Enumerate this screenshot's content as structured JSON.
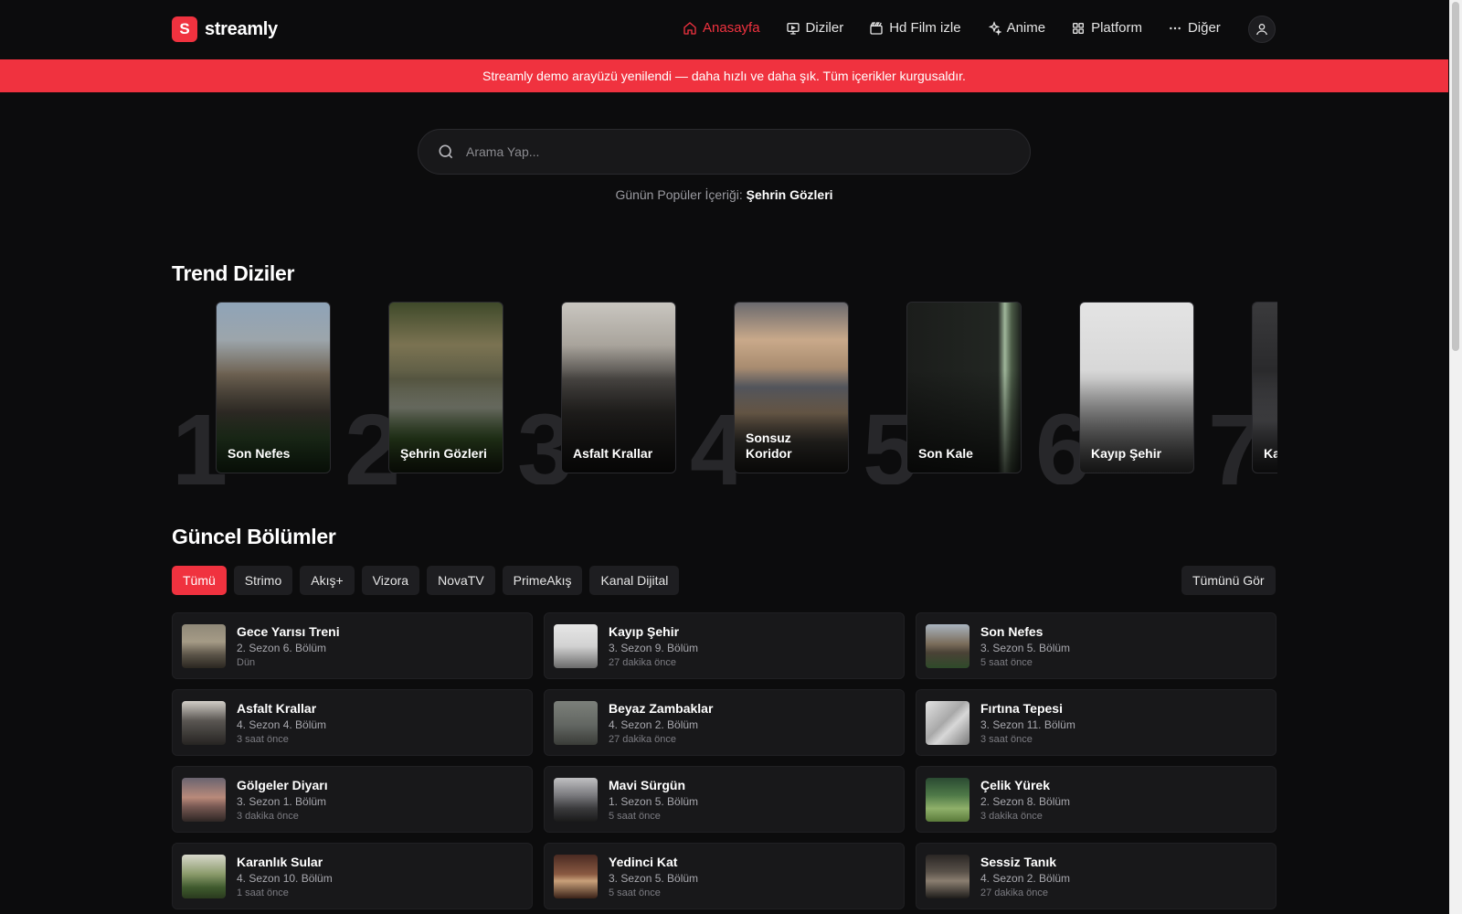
{
  "brand": {
    "logo_letter": "S",
    "name": "streamly"
  },
  "nav": [
    {
      "label": "Anasayfa",
      "icon": "home-icon",
      "active": true
    },
    {
      "label": "Diziler",
      "icon": "tv-icon"
    },
    {
      "label": "Hd Film izle",
      "icon": "clapperboard-icon"
    },
    {
      "label": "Anime",
      "icon": "sparkles-icon"
    },
    {
      "label": "Platform",
      "icon": "grid-icon"
    },
    {
      "label": "Diğer",
      "icon": "more-icon"
    }
  ],
  "banner": {
    "text": "Streamly demo arayüzü yenilendi — daha hızlı ve daha şık. Tüm içerikler kurgusaldır."
  },
  "search": {
    "placeholder": "Arama Yap..."
  },
  "popular": {
    "prefix": "Günün Popüler İçeriği:",
    "title": "Şehrin Gözleri"
  },
  "trend": {
    "title": "Trend Diziler",
    "items": [
      {
        "rank": "1",
        "title": "Son Nefes"
      },
      {
        "rank": "2",
        "title": "Şehrin Gözleri"
      },
      {
        "rank": "3",
        "title": "Asfalt Krallar"
      },
      {
        "rank": "4",
        "title": "Sonsuz Koridor"
      },
      {
        "rank": "5",
        "title": "Son Kale"
      },
      {
        "rank": "6",
        "title": "Kayıp Şehir"
      },
      {
        "rank": "7",
        "title": "Ka"
      }
    ]
  },
  "episodes": {
    "title": "Güncel Bölümler",
    "tabs": [
      "Tümü",
      "Strimo",
      "Akış+",
      "Vizora",
      "NovaTV",
      "PrimeAkış",
      "Kanal Dijital"
    ],
    "active_tab": "Tümü",
    "see_all": "Tümünü Gör",
    "items": [
      {
        "title": "Gece Yarısı Treni",
        "episode": "2. Sezon 6. Bölüm",
        "time": "Dün"
      },
      {
        "title": "Kayıp Şehir",
        "episode": "3. Sezon 9. Bölüm",
        "time": "27 dakika önce"
      },
      {
        "title": "Son Nefes",
        "episode": "3. Sezon 5. Bölüm",
        "time": "5 saat önce"
      },
      {
        "title": "Asfalt Krallar",
        "episode": "4. Sezon 4. Bölüm",
        "time": "3 saat önce"
      },
      {
        "title": "Beyaz Zambaklar",
        "episode": "4. Sezon 2. Bölüm",
        "time": "27 dakika önce"
      },
      {
        "title": "Fırtına Tepesi",
        "episode": "3. Sezon 11. Bölüm",
        "time": "3 saat önce"
      },
      {
        "title": "Gölgeler Diyarı",
        "episode": "3. Sezon 1. Bölüm",
        "time": "3 dakika önce"
      },
      {
        "title": "Mavi Sürgün",
        "episode": "1. Sezon 5. Bölüm",
        "time": "5 saat önce"
      },
      {
        "title": "Çelik Yürek",
        "episode": "2. Sezon 8. Bölüm",
        "time": "3 dakika önce"
      },
      {
        "title": "Karanlık Sular",
        "episode": "4. Sezon 10. Bölüm",
        "time": "1 saat önce"
      },
      {
        "title": "Yedinci Kat",
        "episode": "3. Sezon 5. Bölüm",
        "time": "5 saat önce"
      },
      {
        "title": "Sessiz Tanık",
        "episode": "4. Sezon 2. Bölüm",
        "time": "27 dakika önce"
      }
    ]
  },
  "colors": {
    "accent": "#f0323f",
    "background": "#0c0c0d",
    "card": "#18181a"
  }
}
